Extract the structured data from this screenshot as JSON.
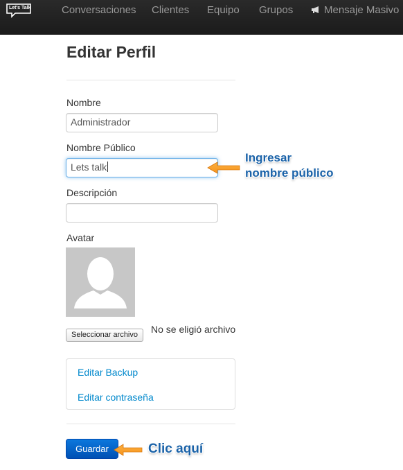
{
  "navbar": {
    "brand_text": "Let's Talk",
    "links": [
      "Conversaciones",
      "Clientes",
      "Equipo",
      "Grupos",
      "Mensaje Masivo"
    ],
    "megaphone_icon": "megaphone-icon"
  },
  "page": {
    "title": "Editar Perfil"
  },
  "form": {
    "nombre_label": "Nombre",
    "nombre_value": "Administrador",
    "nombre_publico_label": "Nombre Público",
    "nombre_publico_value": "Lets talk",
    "descripcion_label": "Descripción",
    "descripcion_value": "",
    "avatar_label": "Avatar",
    "file_button_label": "Seleccionar archivo",
    "file_status": "No se eligió archivo"
  },
  "links": {
    "editar_backup": "Editar Backup",
    "editar_contrasena": "Editar contraseña"
  },
  "actions": {
    "save_label": "Guardar"
  },
  "annotations": {
    "public_name_line1": "Ingresar",
    "public_name_line2": "nombre público",
    "save_hint": "Clic aquí"
  },
  "colors": {
    "navbar_bg": "#222222",
    "link": "#0088cc",
    "primary_button": "#0060c8",
    "annotation_text": "#1a62a8",
    "annotation_arrow": "#f7941d"
  }
}
